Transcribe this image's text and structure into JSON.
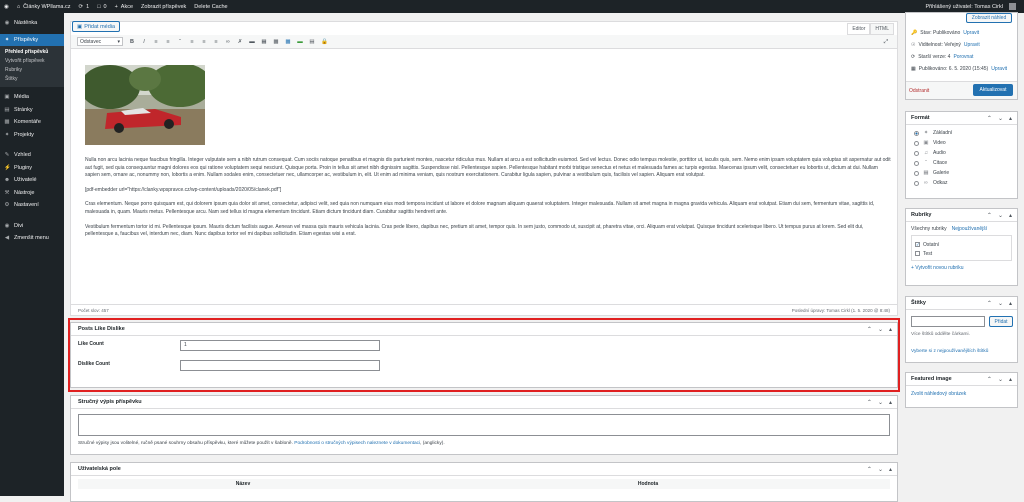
{
  "adminbar": {
    "site_name": "Články WPllama.cz",
    "updates_count": "1",
    "comments_count": "0",
    "new_label": "Akce",
    "view_post": "Zobrazit příspěvek",
    "delete_cache": "Delete Cache",
    "greeting": "Přihlášený uživatel: Tomas Cirkl"
  },
  "sidebar": {
    "items": [
      {
        "label": "Nástěnka",
        "icon": "dashboard-icon"
      },
      {
        "label": "Příspěvky",
        "icon": "pin-icon"
      },
      {
        "label": "Média",
        "icon": "media-icon"
      },
      {
        "label": "Stránky",
        "icon": "pages-icon"
      },
      {
        "label": "Komentáře",
        "icon": "comments-icon"
      },
      {
        "label": "Projekty",
        "icon": "projects-icon"
      },
      {
        "label": "Vzhled",
        "icon": "appearance-icon"
      },
      {
        "label": "Pluginy",
        "icon": "plugins-icon"
      },
      {
        "label": "Uživatelé",
        "icon": "users-icon"
      },
      {
        "label": "Nástroje",
        "icon": "tools-icon"
      },
      {
        "label": "Nastavení",
        "icon": "settings-icon"
      },
      {
        "label": "Divi",
        "icon": "divi-icon"
      },
      {
        "label": "Zmenšit menu",
        "icon": "collapse-icon"
      }
    ],
    "submenu": [
      "Přehled příspěvků",
      "Vytvořit příspěvek",
      "Rubriky",
      "Štítky"
    ]
  },
  "editor": {
    "add_media": "Přidat média",
    "tab_visual": "Editor",
    "tab_text": "HTML",
    "format_select": "Odstavec",
    "paragraphs": [
      "Nulla non arcu lacinia neque faucibus fringilla. Integer vulputate sem a nibh rutrum consequat. Cum sociis natoque penatibus et magnis dis parturient montes, nascetur ridiculus mus. Nullam at arcu a est sollicitudin euismod. Sed vel lectus. Donec odio tempus molestie, porttitor ut, iaculis quis, sem. Nemo enim ipsam voluptatem quia voluptas sit aspernatur aut odit aut fugit, sed quia consequuntur magni dolores eos qui ratione voluptatem sequi nesciunt. Quisque porta. Proin in tellus sit amet nibh dignissim sagittis. Suspendisse nisl. Pellentesque sapien. Pellentesque habitant morbi tristique senectus et netus et malesuada fames ac turpis egestas. Maecenas ipsum velit, consectetuer eu lobortis ut, dictum at dui. Nullam sapien sem, ornare ac, nonummy non, lobortis a enim. Nullam sodales enim, consectetuer nec, ullamcorper ac, vestibulum in, elit. Ut enim ad minima veniam, quis nostrum exercitationem. Curabitur ligula sapien, pulvinar a vestibulum quis, facilisis vel sapien. Aliquam erat volutpat.",
      "[pdf-embedder url=\"https://clanky.wpspravce.cz/wp-content/uploads/2020/05/clanek.pdf\"]",
      "Cras elementum. Neque porro quisquam est, qui dolorem ipsum quia dolor sit amet, consectetur, adipisci velit, sed quia non numquam eius modi tempora incidunt ut labore et dolore magnam aliquam quaerat voluptatem. Integer malesuada. Nullam sit amet magna in magna gravida vehicula. Aliquam erat volutpat. Etiam dui sem, fermentum vitae, sagittis id, malesuada in, quam. Mauris metus. Pellentesque arcu. Nam sed tellus id magna elementum tincidunt. Etiam dictum tincidunt diam. Curabitur sagittis hendrerit ante.",
      "Vestibulum fermentum tortor id mi. Pellentesque ipsum. Mauris dictum facilisis augue. Aenean vel massa quis mauris vehicula lacinia. Cras pede libero, dapibus nec, pretium sit amet, tempor quis. In sem justo, commodo ut, suscipit at, pharetra vitae, orci. Aliquam erat volutpat. Quisque tincidunt scelerisque libero. Ut tempus purus at lorem. Sed elit dui, pellentesque a, faucibus vel, interdum nec, diam. Nunc dapibus tortor vel mi dapibus sollicitudin. Etiam egestas wisi a erat."
    ],
    "word_count": "Počet slov: 457",
    "last_edit": "Poslední úpravy: Tomas Cirkl (1. 5. 2020 @ 8:48)"
  },
  "likes_box": {
    "title": "Posts Like Dislike",
    "like_label": "Like Count",
    "like_value": "1",
    "dislike_label": "Dislike Count",
    "dislike_value": ""
  },
  "excerpt_box": {
    "title": "Stručný výpis příspěvku",
    "help_before": "Stručné výpisy jsou volitelné, ručně psané souhrny obsahu příspěvku, které můžete použít v šabloně.",
    "help_link": "Podrobnosti o stručných výpisech naleznete v dokumentaci",
    "help_after": ", (anglicky)."
  },
  "custom_fields": {
    "title": "Uživatelská pole",
    "col_name": "Název",
    "col_value": "Hodnota"
  },
  "publish_box": {
    "preview": "Zobrazit náhled",
    "status": "Stav: Publikováno",
    "status_edit": "Upravit",
    "visibility": "Viditelnost: Veřejný",
    "visibility_edit": "Upravit",
    "revisions": "Starší verze: 4",
    "revisions_link": "Porovnat",
    "published": "Publikováno: 6. 5. 2020 (15:45)",
    "published_edit": "Upravit",
    "trash": "Odstranit",
    "update": "Aktualizovat"
  },
  "format_box": {
    "title": "Formát",
    "options": [
      {
        "label": "Základní",
        "icon": "pin-icon",
        "checked": true
      },
      {
        "label": "Video",
        "icon": "video-icon",
        "checked": false
      },
      {
        "label": "Audio",
        "icon": "audio-icon",
        "checked": false
      },
      {
        "label": "Citace",
        "icon": "quote-icon",
        "checked": false
      },
      {
        "label": "Galerie",
        "icon": "gallery-icon",
        "checked": false
      },
      {
        "label": "Odkaz",
        "icon": "link-icon",
        "checked": false
      }
    ]
  },
  "category_box": {
    "title": "Rubriky",
    "tab_all": "Všechny rubriky",
    "tab_popular": "Nejpoužívanější",
    "items": [
      {
        "label": "Ostatní",
        "checked": true
      },
      {
        "label": "Test",
        "checked": false
      }
    ],
    "add_new": "+ Vytvořit novou rubriku"
  },
  "tags_box": {
    "title": "Štítky",
    "add_button": "Přidat",
    "help": "Více štítků oddělte čárkami.",
    "choose": "Vyberte si z nejpoužívanějších štítků"
  },
  "featured_box": {
    "title": "Featured image",
    "set_link": "Zvolit náhledový obrázek"
  },
  "colors": {
    "accent": "#2271b1",
    "admin_dark": "#1d2327",
    "highlight": "#e02020"
  }
}
